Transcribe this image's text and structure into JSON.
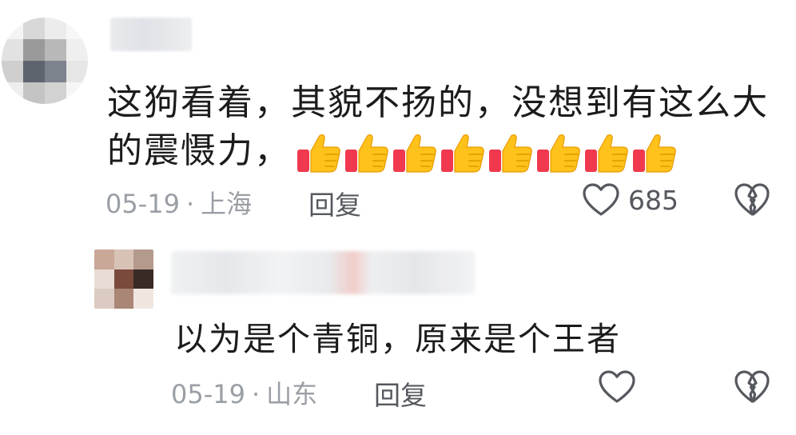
{
  "comments": {
    "main": {
      "text_line1": "这狗看着，其貌不扬的，没想到有这么大",
      "text_line2": "的震慑力，",
      "emoji": "thumbs-up-emoji",
      "emoji_count": 8,
      "date": "05-19",
      "separator": "·",
      "location": "上海",
      "reply_label": "回复",
      "like_icon": "heart-outline-icon",
      "like_count": "685",
      "dislike_icon": "broken-heart-icon"
    },
    "reply": {
      "text": "以为是个青铜，原来是个王者",
      "date": "05-19",
      "separator": "·",
      "location": "山东",
      "reply_label": "回复",
      "like_icon": "heart-outline-icon",
      "dislike_icon": "broken-heart-icon"
    }
  },
  "colors": {
    "text": "#1c1c1c",
    "meta": "#9a9ea5",
    "action": "#55585e",
    "thumb_yellow": "#ffc21a",
    "thumb_red": "#f0384e"
  }
}
